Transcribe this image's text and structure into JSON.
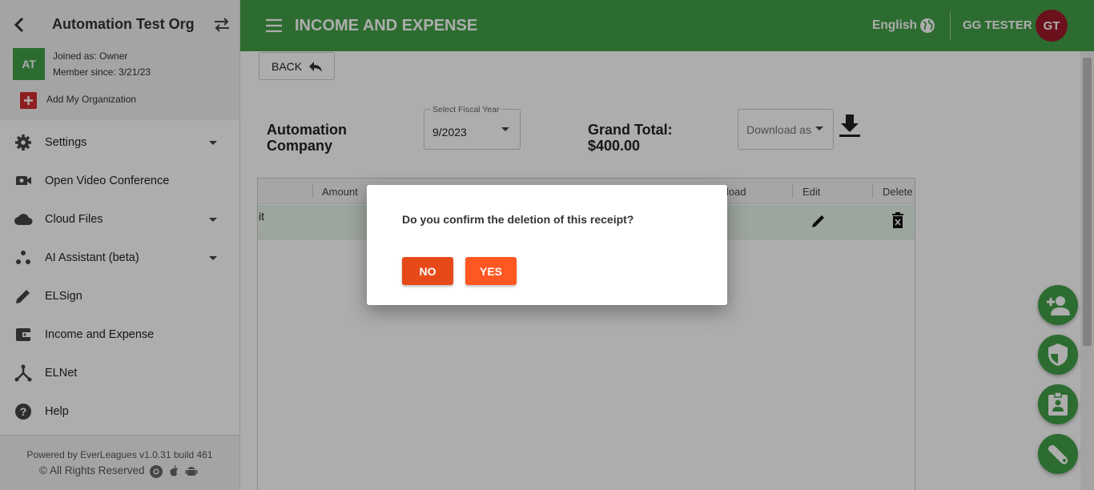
{
  "sidebar": {
    "org_name": "Automation Test Org",
    "avatar_initials": "AT",
    "joined_as": "Joined as: Owner",
    "member_since": "Member since: 3/21/23",
    "add_org": "Add My Organization",
    "items": [
      {
        "label": "Settings",
        "icon": "gear-icon",
        "has_caret": true
      },
      {
        "label": "Open Video Conference",
        "icon": "video-camera-icon",
        "has_caret": false
      },
      {
        "label": "Cloud Files",
        "icon": "cloud-icon",
        "has_caret": true
      },
      {
        "label": "AI Assistant (beta)",
        "icon": "ai-dots-icon",
        "has_caret": true
      },
      {
        "label": "ELSign",
        "icon": "pencil-icon",
        "has_caret": false
      },
      {
        "label": "Income and Expense",
        "icon": "wallet-icon",
        "has_caret": false
      },
      {
        "label": "ELNet",
        "icon": "network-icon",
        "has_caret": false
      },
      {
        "label": "Help",
        "icon": "help-icon",
        "has_caret": false
      }
    ],
    "powered_by": "Powered by EverLeagues v1.0.31 build 461",
    "rights": "© All Rights Reserved"
  },
  "topbar": {
    "title": "INCOME AND EXPENSE",
    "language": "English",
    "user_name": "GG TESTER",
    "user_initials": "GT"
  },
  "main": {
    "back_label": "BACK",
    "company": "Automation Company",
    "fiscal_year_label": "Select Fiscal Year",
    "fiscal_year_value": "9/2023",
    "grand_total": "Grand Total: $400.00",
    "download_label": "Download as",
    "table": {
      "headers": [
        "Amount",
        "load",
        "Edit",
        "Delete"
      ],
      "row_desc": "it"
    }
  },
  "dialog": {
    "message": "Do you confirm the deletion of this receipt?",
    "no_label": "NO",
    "yes_label": "YES"
  },
  "colors": {
    "brand_green": "#43a047",
    "danger_orange": "#ff5722"
  }
}
